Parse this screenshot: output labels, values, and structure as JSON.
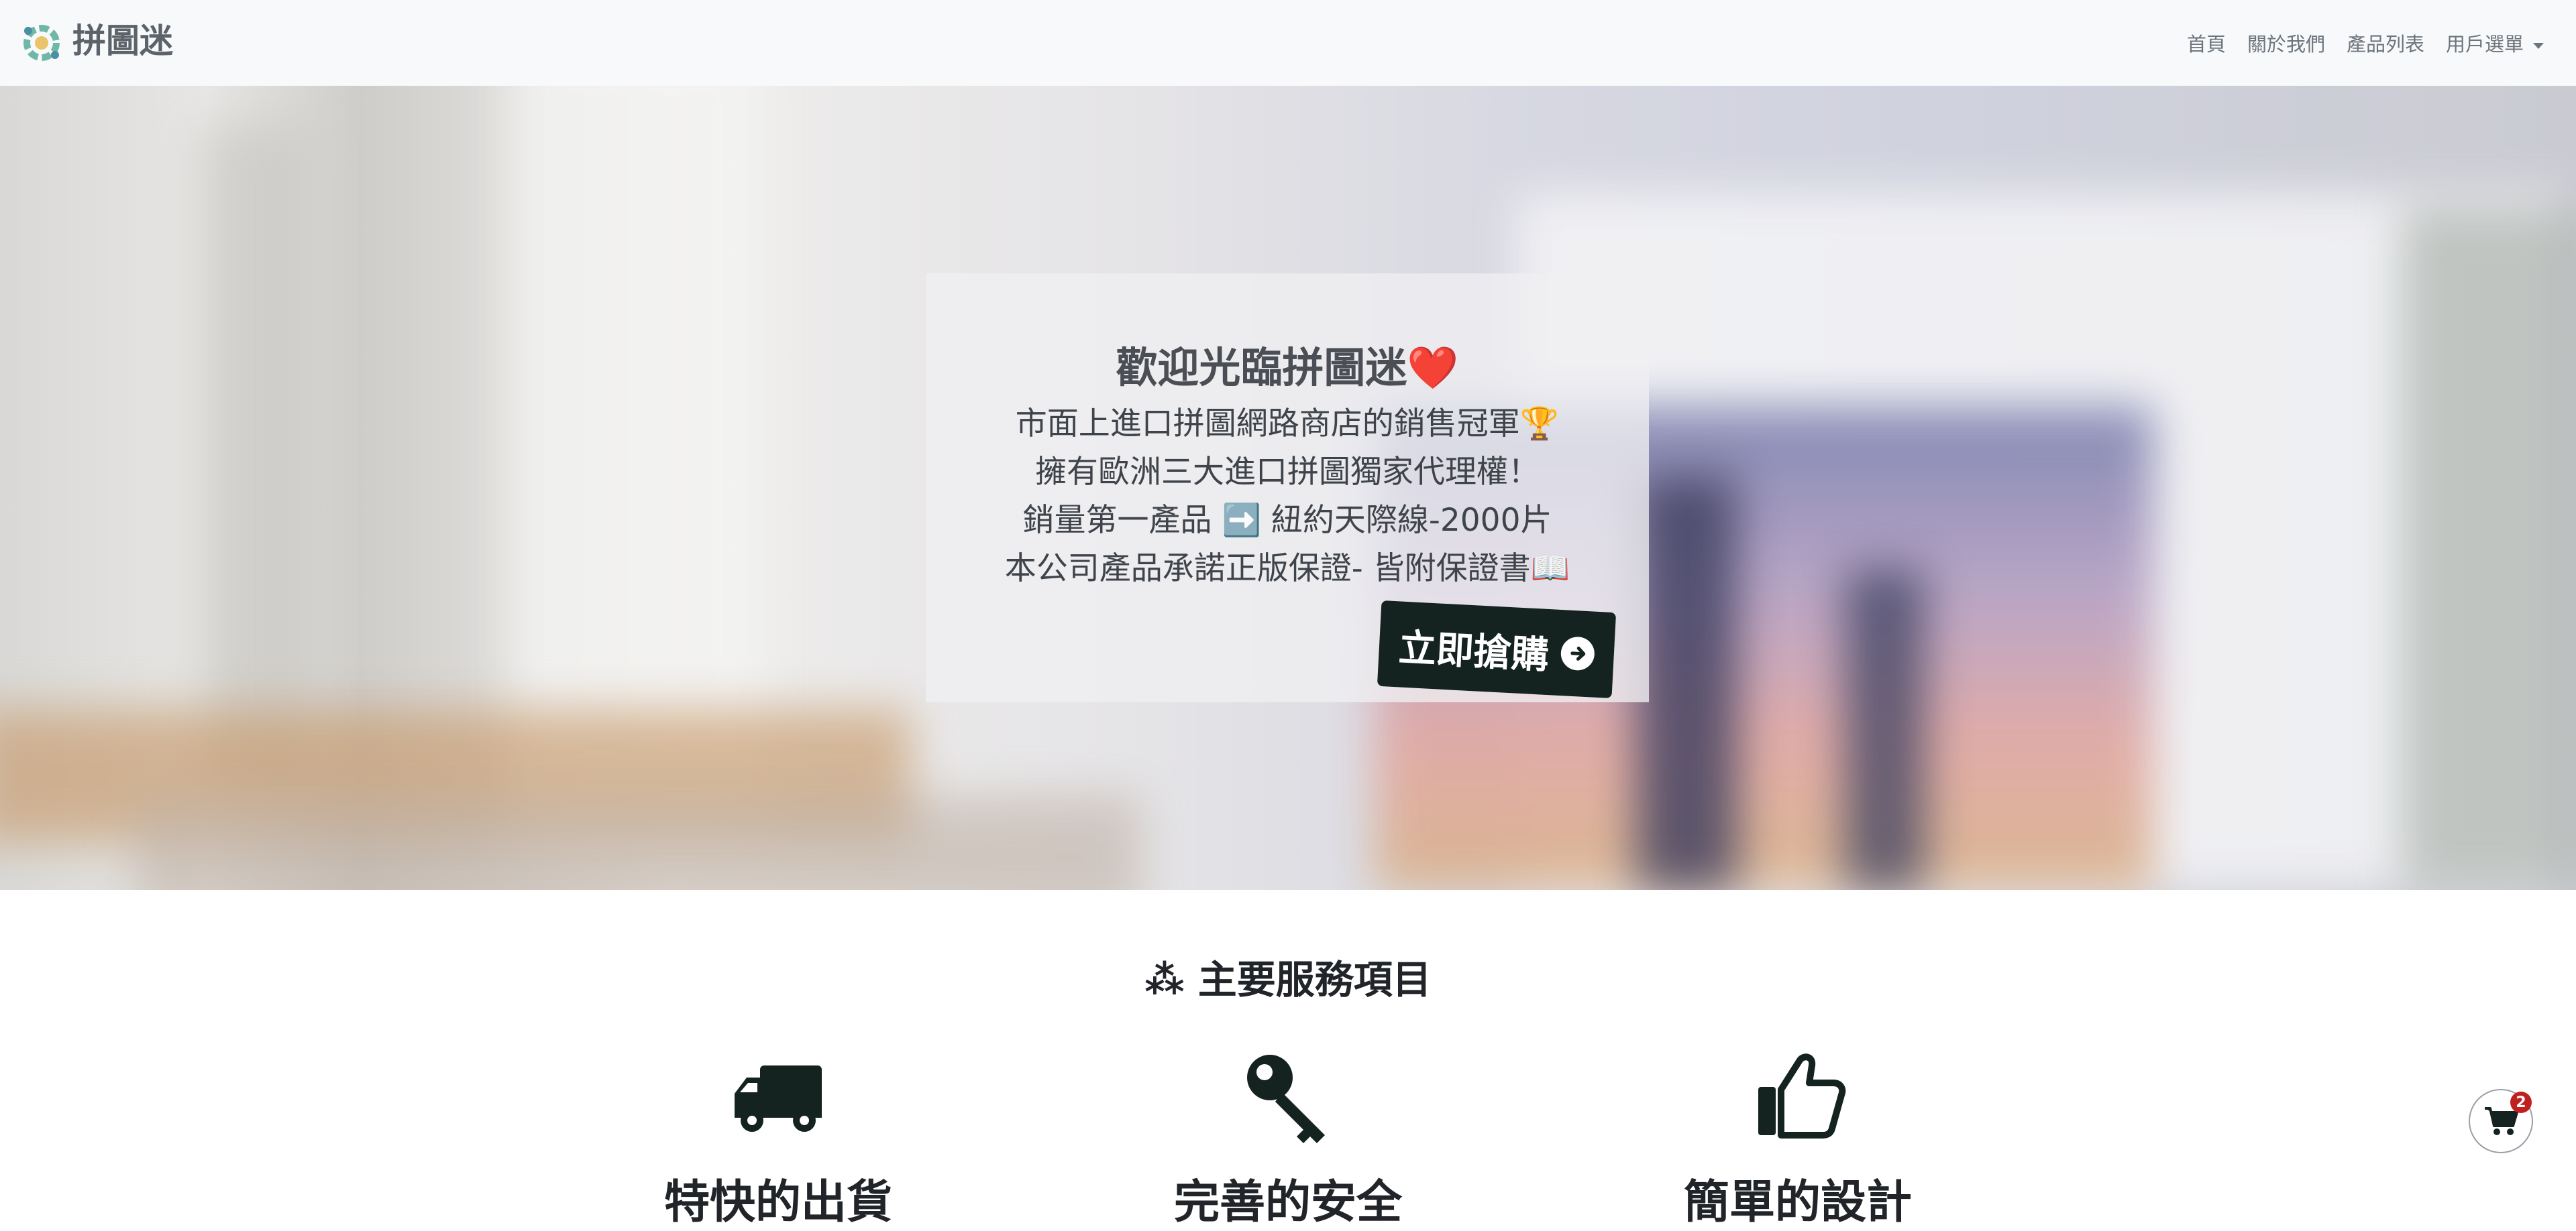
{
  "navbar": {
    "brand": "拼圖迷",
    "links": [
      "首頁",
      "關於我們",
      "產品列表",
      "用戶選單"
    ]
  },
  "hero": {
    "title": "歡迎光臨拼圖迷❤️",
    "lines": [
      "市面上進口拼圖網路商店的銷售冠軍🏆",
      "擁有歐洲三大進口拼圖獨家代理權！",
      "銷量第一產品 ➡️ 紐約天際線-2000片",
      "本公司產品承諾正版保證- 皆附保證書📖"
    ],
    "button_label": "立即搶購"
  },
  "services": {
    "heading": "⁂ 主要服務項目",
    "items": [
      {
        "title": "特快的出貨",
        "icon": "truck-icon"
      },
      {
        "title": "完善的安全",
        "icon": "key-icon"
      },
      {
        "title": "簡單的設計",
        "icon": "thumbs-up-icon"
      }
    ]
  },
  "cart": {
    "count": "2",
    "icon": "shopping-cart-icon"
  },
  "colors": {
    "navbar_bg": "#f8f9fa",
    "button_bg": "#142320",
    "badge": "#c0201e",
    "icon": "#142320"
  }
}
